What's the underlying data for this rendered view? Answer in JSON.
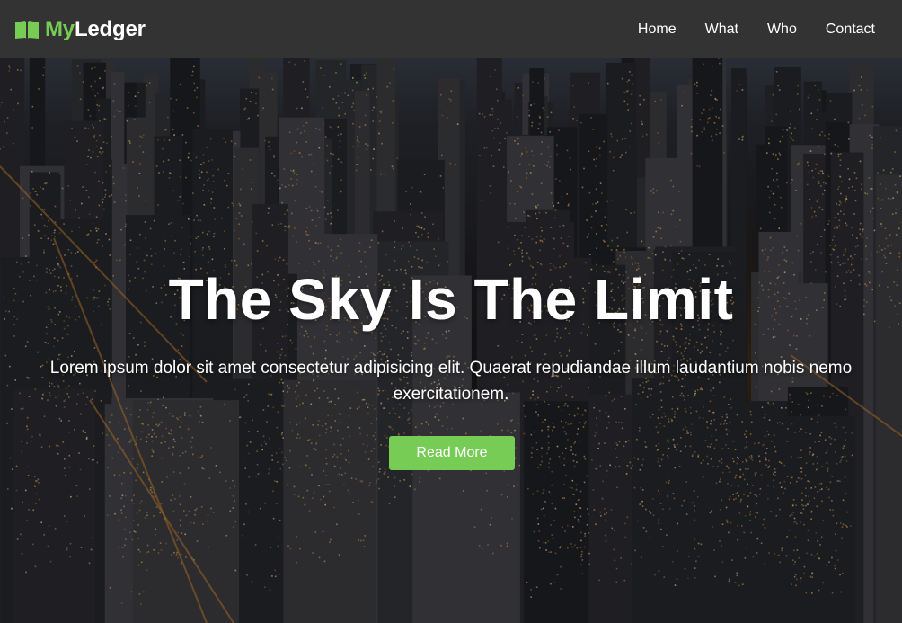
{
  "brand": {
    "prefix": "My",
    "suffix": "Ledger",
    "icon": "book-icon",
    "accent_color": "#77cc55"
  },
  "nav": {
    "items": [
      {
        "label": "Home"
      },
      {
        "label": "What"
      },
      {
        "label": "Who"
      },
      {
        "label": "Contact"
      }
    ]
  },
  "hero": {
    "background": "night city skyline aerial photo",
    "title": "The Sky Is The Limit",
    "description": "Lorem ipsum dolor sit amet consectetur adipisicing elit. Quaerat repudiandae illum laudantium nobis nemo exercitationem.",
    "button_label": "Read More"
  },
  "colors": {
    "navbar_bg": "#333333",
    "accent": "#77cc55",
    "text": "#ffffff"
  }
}
